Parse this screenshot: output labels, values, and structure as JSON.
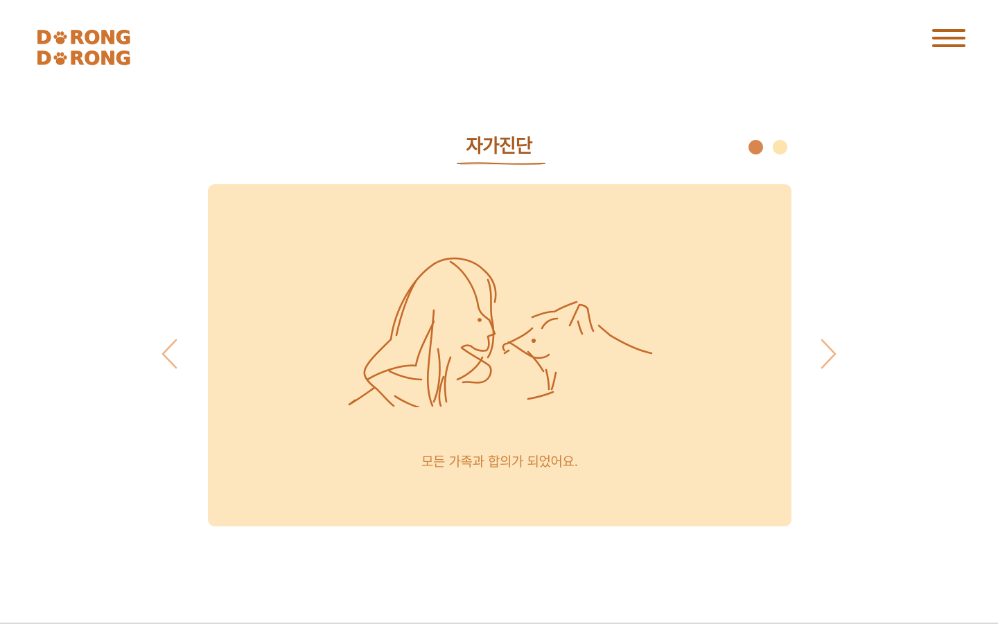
{
  "header": {
    "logo_line1_a": "D",
    "logo_line1_b": "RONG",
    "logo_line2_a": "D",
    "logo_line2_b": "RONG"
  },
  "page_title": "자가진단",
  "carousel": {
    "current_slide": 1,
    "total_slides": 2,
    "caption": "모든 가족과 합의가 되었어요."
  },
  "icons": {
    "menu": "hamburger-icon",
    "prev": "chevron-left-icon",
    "next": "chevron-right-icon",
    "paw": "paw-icon",
    "illustration": "woman-and-dog-illustration"
  },
  "colors": {
    "brand": "#d0742e",
    "brand_dark": "#b5621d",
    "card_bg": "#fde6bd",
    "dot_active": "#d9864e",
    "dot_inactive": "#fde3ad",
    "caption": "#d0813d",
    "arrow": "#f0b283"
  }
}
